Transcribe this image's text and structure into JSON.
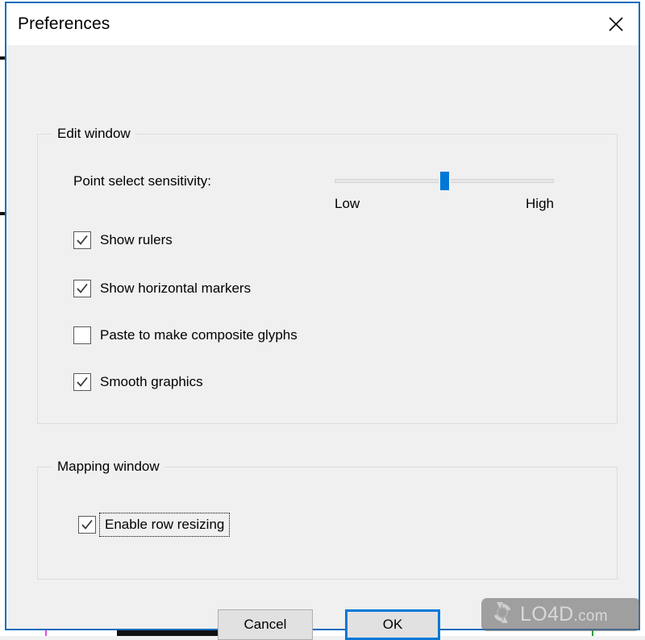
{
  "window": {
    "title": "Preferences",
    "close_icon": "close-icon",
    "accent_color": "#0f6cbd",
    "background_color": "#f0f0f0"
  },
  "groups": {
    "edit": {
      "title": "Edit window",
      "sensitivity": {
        "label": "Point select sensitivity:",
        "low_label": "Low",
        "high_label": "High",
        "value_percent": 50,
        "thumb_color": "#0078d7"
      },
      "checkboxes": [
        {
          "label": "Show rulers",
          "checked": true,
          "focused": false
        },
        {
          "label": "Show horizontal markers",
          "checked": true,
          "focused": false
        },
        {
          "label": "Paste to make composite glyphs",
          "checked": false,
          "focused": false
        },
        {
          "label": "Smooth graphics",
          "checked": true,
          "focused": false
        }
      ]
    },
    "mapping": {
      "title": "Mapping window",
      "checkboxes": [
        {
          "label": "Enable row resizing",
          "checked": true,
          "focused": true
        }
      ]
    }
  },
  "buttons": {
    "cancel": "Cancel",
    "ok": "OK"
  },
  "watermark": {
    "text": "LO4D",
    "suffix": ".com",
    "logo_icon": "refresh-arrows-icon"
  }
}
